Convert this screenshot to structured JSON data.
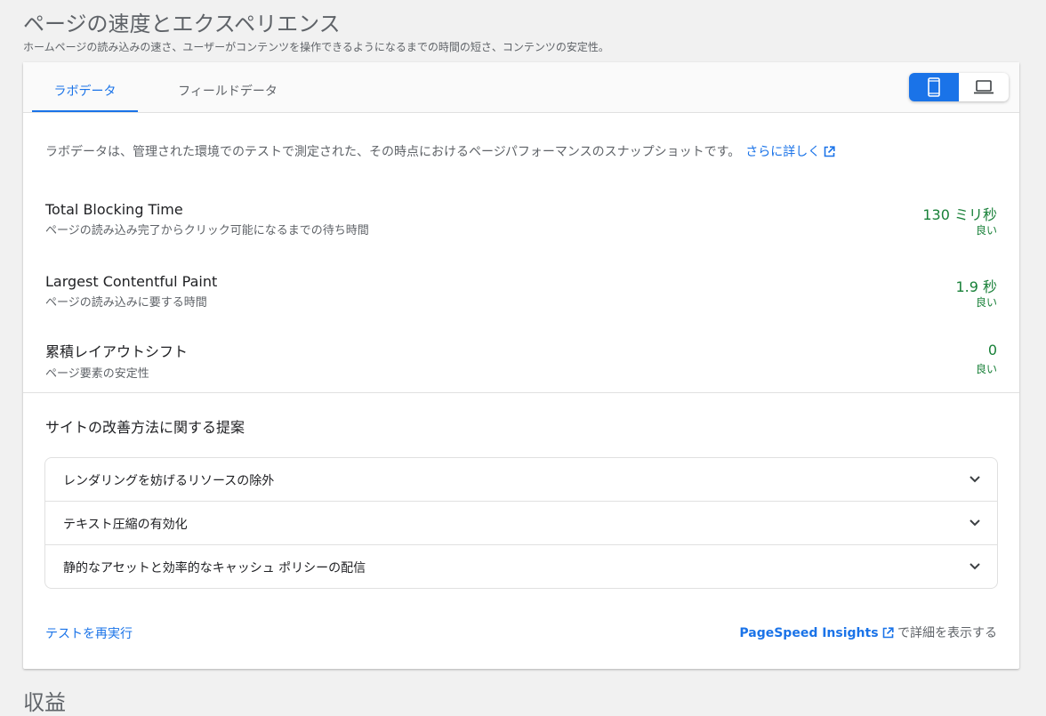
{
  "header": {
    "title": "ページの速度とエクスペリエンス",
    "subtitle": "ホームページの読み込みの速さ、ユーザーがコンテンツを操作できるようになるまでの時間の短さ、コンテンツの安定性。"
  },
  "tabs": {
    "lab": "ラボデータ",
    "field": "フィールドデータ",
    "active": "lab"
  },
  "device_toggle": {
    "options": [
      "mobile-icon",
      "laptop-icon"
    ],
    "selected": "mobile"
  },
  "intro": {
    "text": "ラボデータは、管理された環境でのテストで測定された、その時点におけるページパフォーマンスのスナップショットです。",
    "link": "さらに詳しく"
  },
  "metrics": [
    {
      "name": "Total Blocking Time",
      "description": "ページの読み込み完了からクリック可能になるまでの待ち時間",
      "value": "130 ミリ秒",
      "rating": "良い"
    },
    {
      "name": "Largest Contentful Paint",
      "description": "ページの読み込みに要する時間",
      "value": "1.9 秒",
      "rating": "良い"
    },
    {
      "name": "累積レイアウトシフト",
      "description": "ページ要素の安定性",
      "value": "0",
      "rating": "良い"
    }
  ],
  "suggestions": {
    "title": "サイトの改善方法に関する提案",
    "items": [
      "レンダリングを妨げるリソースの除外",
      "テキスト圧縮の有効化",
      "静的なアセットと効率的なキャッシュ ポリシーの配信"
    ]
  },
  "footer": {
    "rerun": "テストを再実行",
    "psi_link": "PageSpeed Insights",
    "psi_suffix": "で詳細を表示する"
  },
  "next_section": {
    "title": "収益"
  },
  "colors": {
    "accent": "#1a73e8",
    "good": "#188038"
  }
}
